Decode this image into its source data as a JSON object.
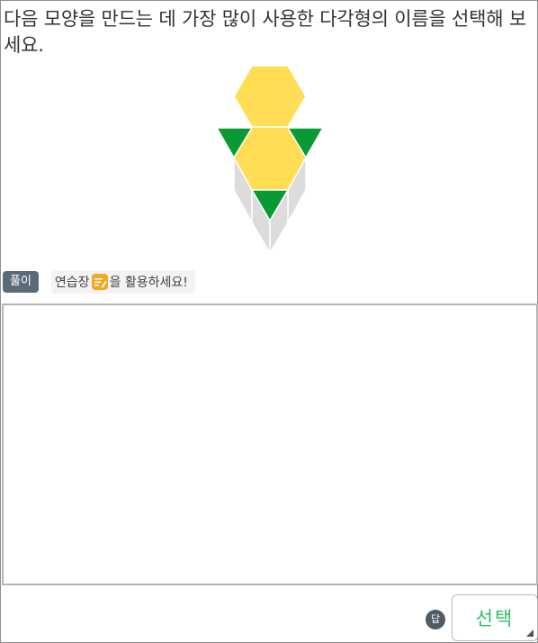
{
  "question": {
    "text": "다음 모양을 만드는 데 가장 많이 사용한 다각형의 이름을 선택해 보세요."
  },
  "solve": {
    "badge": "풀이",
    "hint_before": "연습장",
    "hint_after": "을 활용하세요!"
  },
  "answer": {
    "badge": "답",
    "select_label": "선택"
  },
  "colors": {
    "hexagon": "#ffdd55",
    "triangle": "#0a9a34",
    "rhombus": "#dcdcdc",
    "accent_green": "#2fbf66",
    "pencil": "#f5a623"
  },
  "icons": {
    "pencil": "pencil-icon",
    "dropdown": "dropdown-arrow-icon"
  }
}
